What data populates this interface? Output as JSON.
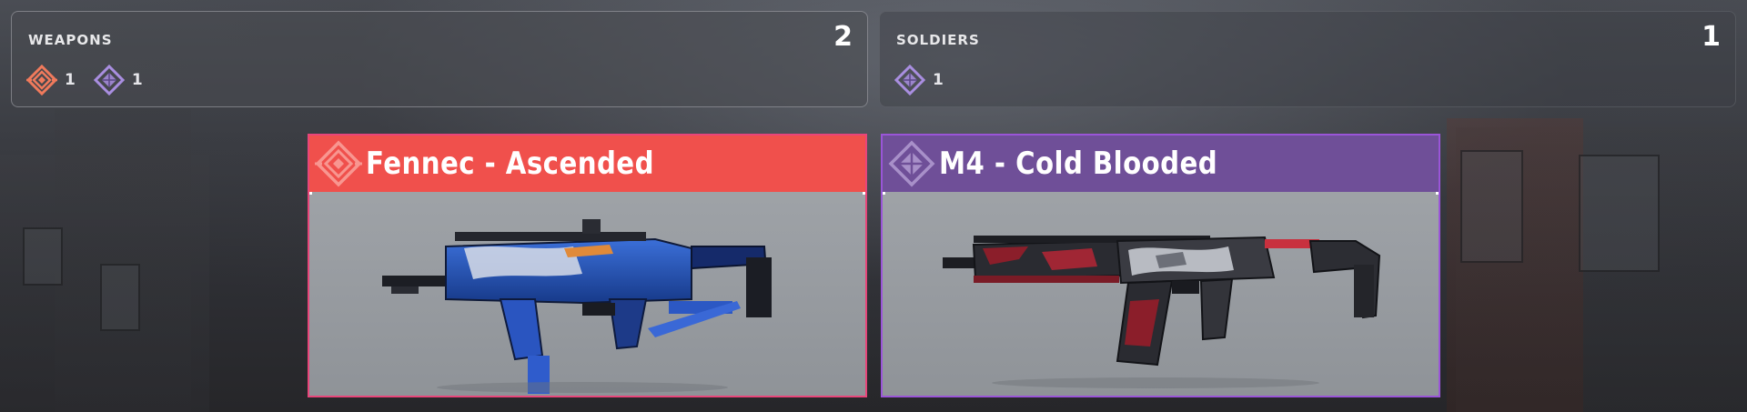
{
  "summary": {
    "weapons": {
      "label": "WEAPONS",
      "total": "2",
      "rarities": [
        {
          "icon": "ascended-rarity-icon",
          "color": "#f07a5c",
          "count": "1"
        },
        {
          "icon": "legendary-rarity-icon",
          "color": "#a98ee0",
          "count": "1"
        }
      ]
    },
    "soldiers": {
      "label": "SOLDIERS",
      "total": "1",
      "rarities": [
        {
          "icon": "legendary-rarity-icon",
          "color": "#a98ee0",
          "count": "1"
        }
      ]
    }
  },
  "items": [
    {
      "title": "Fennec - Ascended",
      "rarity_icon": "ascended-rarity-icon",
      "header_color": "#f0504c",
      "border_color": "#e8457a",
      "art": "fennec-smg-image"
    },
    {
      "title": "M4 - Cold Blooded",
      "rarity_icon": "legendary-rarity-icon",
      "header_color": "#6f4f98",
      "border_color": "#9a55d8",
      "art": "m4-rifle-image"
    }
  ],
  "colors": {
    "ascended": "#f0504c",
    "legendary": "#6f4f98"
  }
}
